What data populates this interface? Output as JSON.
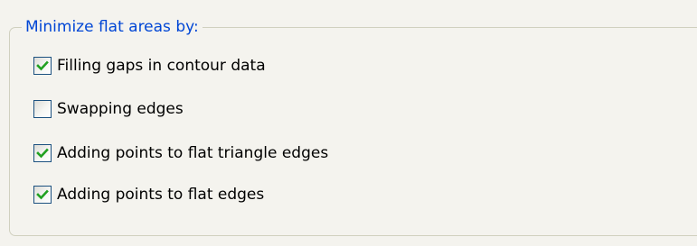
{
  "group": {
    "title": "Minimize flat areas by:"
  },
  "options": [
    {
      "label": "Filling gaps in contour data",
      "checked": true
    },
    {
      "label": "Swapping edges",
      "checked": false
    },
    {
      "label": "Adding points to flat triangle edges",
      "checked": true
    },
    {
      "label": "Adding points to flat edges",
      "checked": true
    }
  ],
  "colors": {
    "legend_text": "#0046d5",
    "checkmark": "#21a121",
    "checkbox_border": "#1c5180",
    "background": "#f4f3ee"
  }
}
